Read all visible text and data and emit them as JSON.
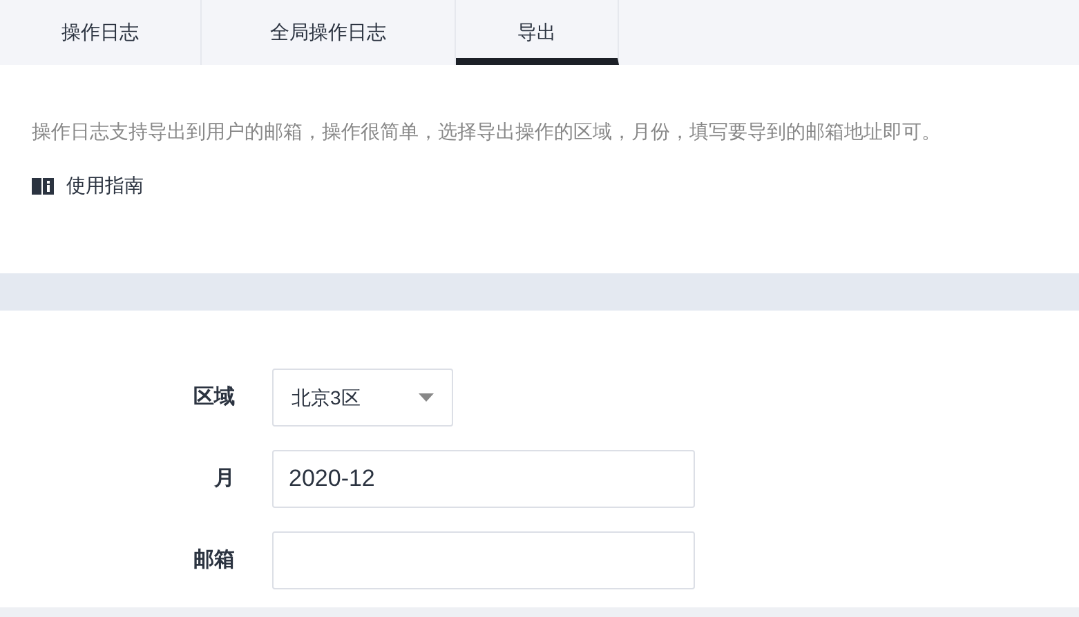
{
  "tabs": [
    {
      "label": "操作日志",
      "selected": false
    },
    {
      "label": "全局操作日志",
      "selected": false
    },
    {
      "label": "导出",
      "selected": true
    }
  ],
  "intro": {
    "text": "操作日志支持导出到用户的邮箱，操作很简单，选择导出操作的区域，月份，填写要导到的邮箱地址即可。",
    "guide_link": "使用指南"
  },
  "form": {
    "fields": [
      {
        "kind": "select",
        "label": "区域",
        "value": "北京3区"
      },
      {
        "kind": "input",
        "label": "月",
        "value": "2020-12"
      },
      {
        "kind": "input",
        "label": "邮箱"
      }
    ]
  }
}
